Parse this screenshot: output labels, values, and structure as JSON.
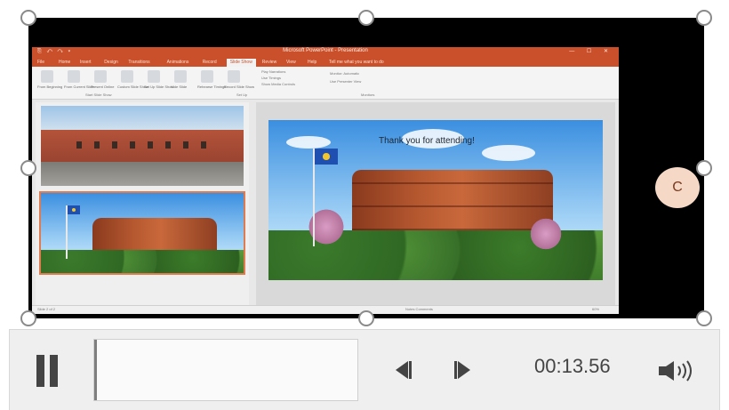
{
  "video": {
    "selected": true,
    "speaker_initial": "C"
  },
  "ppt": {
    "window_title": "Microsoft PowerPoint - Presentation",
    "quick_access": "⎘ ↶ ↷ ▾",
    "window_controls": "— ☐ ✕",
    "tabs": [
      "File",
      "Home",
      "Insert",
      "Design",
      "Transitions",
      "Animations",
      "Record",
      "Slide Show",
      "Review",
      "View",
      "Help",
      "Tell me what you want to do"
    ],
    "active_tab_index": 7,
    "ribbon_groups": [
      "Start Slide Show",
      "Set Up",
      "Monitors"
    ],
    "ribbon_buttons": [
      "From Beginning",
      "From Current Slide",
      "Present Online",
      "Custom Slide Show",
      "Set Up Slide Show",
      "Hide Slide",
      "Rehearse Timings",
      "Record Slide Show"
    ],
    "ribbon_checks": [
      "Play Narrations",
      "Use Timings",
      "Show Media Controls"
    ],
    "monitor_options": [
      "Monitor: Automatic",
      "Use Presenter View"
    ],
    "status_left": "Slide 2 of 2",
    "status_right": "Notes   Comments",
    "zoom": "60%"
  },
  "slide": {
    "text": "Thank you for attending!"
  },
  "controls": {
    "time": "00:13.56",
    "progress": 0.01
  },
  "colors": {
    "accent": "#c9502a",
    "selection": "#e07a4f",
    "badge": "#f6d8c7"
  },
  "icons": {
    "pause": "pause-icon",
    "back": "step-back-icon",
    "forward": "step-forward-icon",
    "volume": "volume-icon"
  }
}
